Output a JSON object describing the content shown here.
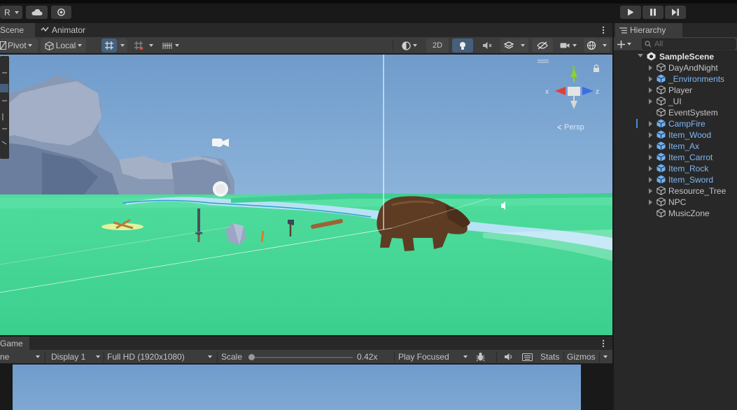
{
  "toolbar": {
    "account_label": "R",
    "play_icon": "play-icon",
    "pause_icon": "pause-icon",
    "step_icon": "step-icon"
  },
  "scene_panel": {
    "tabs": [
      "Scene",
      "Animator"
    ],
    "pivot_label": "Pivot",
    "local_label": "Local",
    "toggle_2d_label": "2D",
    "persp_label": "Persp",
    "gizmo_axes": {
      "x": "x",
      "y": "y",
      "z": "z"
    }
  },
  "game_panel": {
    "tab": "Game",
    "tab_mode_fragment": "ne",
    "display": "Display 1",
    "resolution": "Full HD (1920x1080)",
    "scale_label": "Scale",
    "scale_value": "0.42x",
    "scale_fraction": 0.02,
    "play_mode": "Play Focused",
    "stats_label": "Stats",
    "gizmos_label": "Gizmos"
  },
  "hierarchy": {
    "tab": "Hierarchy",
    "search_placeholder": "All",
    "scene_name": "SampleScene",
    "items": [
      {
        "label": "DayAndNight",
        "prefab": false,
        "expandable": true
      },
      {
        "label": "_Environments",
        "prefab": true,
        "expandable": true
      },
      {
        "label": "Player",
        "prefab": false,
        "expandable": true
      },
      {
        "label": "_UI",
        "prefab": false,
        "expandable": true
      },
      {
        "label": "EventSystem",
        "prefab": false,
        "expandable": false
      },
      {
        "label": "CampFire",
        "prefab": true,
        "expandable": true
      },
      {
        "label": "Item_Wood",
        "prefab": true,
        "expandable": true
      },
      {
        "label": "Item_Ax",
        "prefab": true,
        "expandable": true
      },
      {
        "label": "Item_Carrot",
        "prefab": true,
        "expandable": true
      },
      {
        "label": "Item_Rock",
        "prefab": true,
        "expandable": true
      },
      {
        "label": "Item_Sword",
        "prefab": true,
        "expandable": true
      },
      {
        "label": "Resource_Tree",
        "prefab": false,
        "expandable": true
      },
      {
        "label": "NPC",
        "prefab": false,
        "expandable": true
      },
      {
        "label": "MusicZone",
        "prefab": false,
        "expandable": false
      }
    ]
  },
  "colors": {
    "editor_bg": "#191919",
    "panel_bg": "#282828",
    "toolbar_bg": "#3c3c3c",
    "prefab_text": "#7fb7f5",
    "selected_tool": "#46607c",
    "sky": "#7aa3cf",
    "grass": "#45d99a",
    "water": "#a9dbf4"
  }
}
